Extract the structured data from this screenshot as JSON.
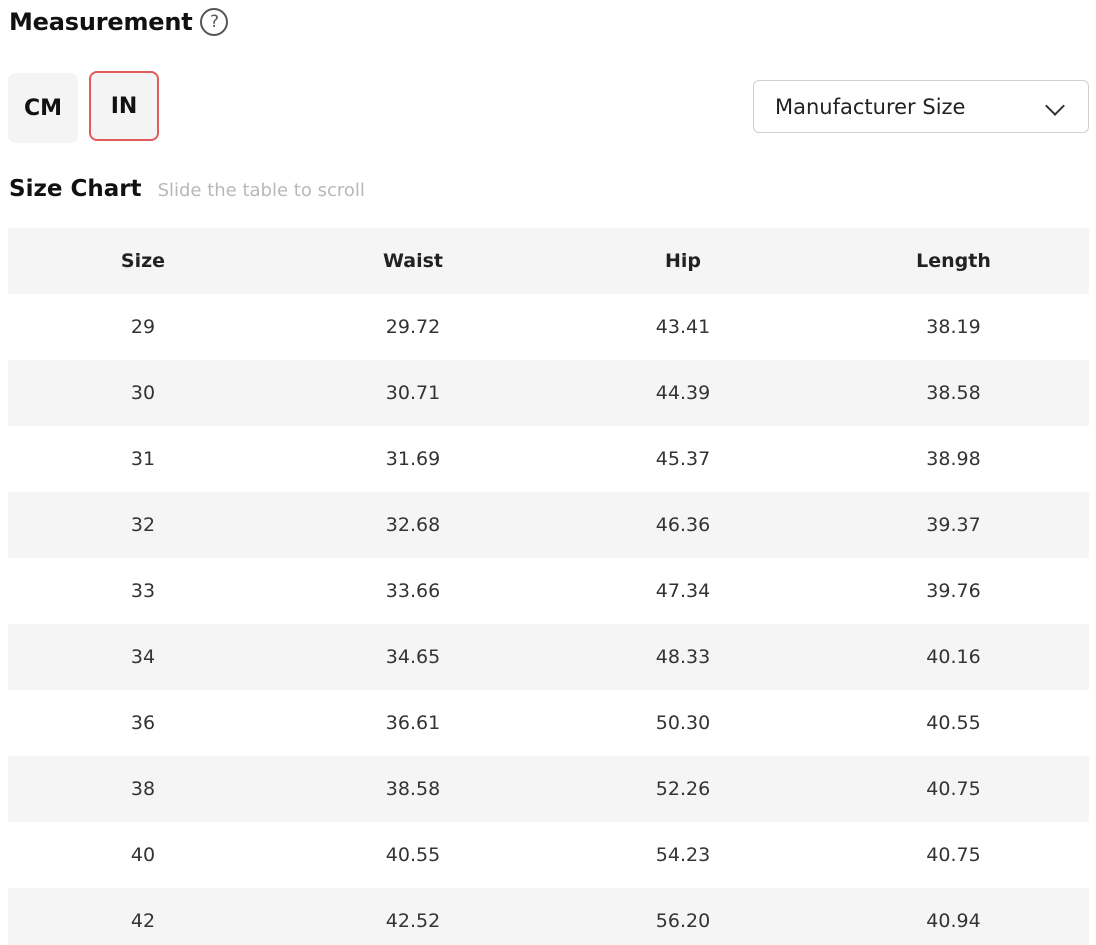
{
  "header": {
    "title": "Measurement",
    "help_icon_glyph": "?"
  },
  "units": {
    "cm_label": "CM",
    "in_label": "IN",
    "selected": "IN",
    "selected_border_color": "#e25c5c"
  },
  "size_select": {
    "value": "Manufacturer Size"
  },
  "size_chart": {
    "title": "Size Chart",
    "hint": "Slide the table to scroll",
    "columns": [
      "Size",
      "Waist",
      "Hip",
      "Length"
    ],
    "rows": [
      [
        "29",
        "29.72",
        "43.41",
        "38.19"
      ],
      [
        "30",
        "30.71",
        "44.39",
        "38.58"
      ],
      [
        "31",
        "31.69",
        "45.37",
        "38.98"
      ],
      [
        "32",
        "32.68",
        "46.36",
        "39.37"
      ],
      [
        "33",
        "33.66",
        "47.34",
        "39.76"
      ],
      [
        "34",
        "34.65",
        "48.33",
        "40.16"
      ],
      [
        "36",
        "36.61",
        "50.30",
        "40.55"
      ],
      [
        "38",
        "38.58",
        "52.26",
        "40.75"
      ],
      [
        "40",
        "40.55",
        "54.23",
        "40.75"
      ],
      [
        "42",
        "42.52",
        "56.20",
        "40.94"
      ]
    ]
  }
}
